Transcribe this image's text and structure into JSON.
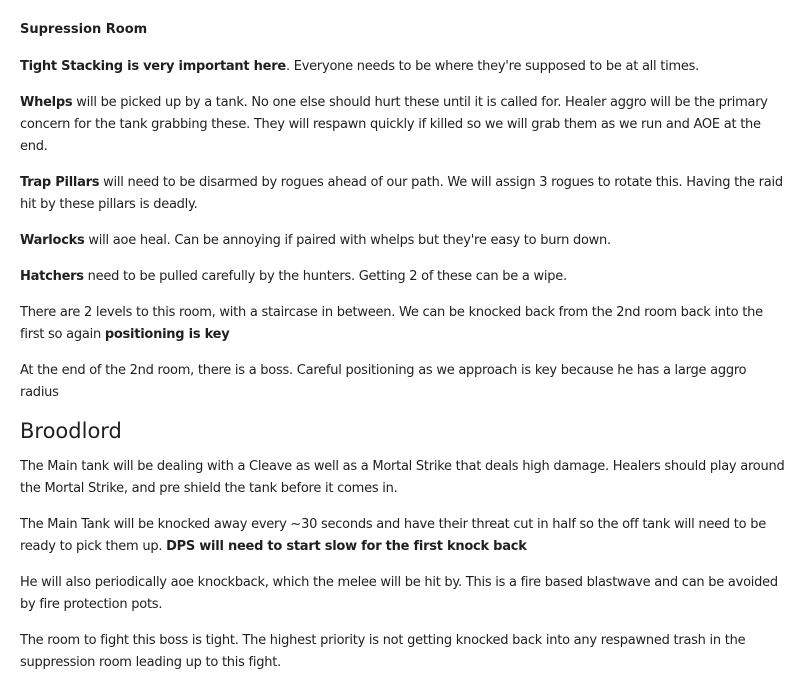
{
  "suppression": {
    "heading": "Supression Room",
    "p1": {
      "bold": "Tight Stacking is very important here",
      "rest": ". Everyone needs to be where they're supposed to be at all times."
    },
    "p2": {
      "bold": "Whelps",
      "rest": " will be picked up by a tank. No one else should hurt these until it is called for. Healer aggro will be the primary concern for the tank grabbing these. They will respawn quickly if killed so we will grab them as we run and AOE at the end."
    },
    "p3": {
      "bold": "Trap Pillars",
      "rest": " will need to be disarmed by rogues ahead of our path. We will assign 3 rogues to rotate this. Having the raid hit by these pillars is deadly."
    },
    "p4": {
      "bold": "Warlocks",
      "rest": " will aoe heal. Can be annoying if paired with whelps but they're easy to burn down."
    },
    "p5": {
      "bold": "Hatchers",
      "rest": " need to be pulled carefully by the hunters. Getting 2 of these can be a wipe."
    },
    "p6": {
      "text": "There are 2 levels to this room, with a staircase in between. We can be knocked back from the 2nd room back into the first so again ",
      "bold": "positioning is key"
    },
    "p7": {
      "text": "At the end of the 2nd room, there is a boss. Careful positioning as we approach is key because he has a large aggro radius"
    }
  },
  "broodlord": {
    "heading": "Broodlord",
    "p1": {
      "text": "The Main tank will be dealing with a Cleave as well as a Mortal Strike that deals high damage. Healers should play around the Mortal Strike, and pre shield the tank before it comes in."
    },
    "p2": {
      "text": "The Main Tank will be knocked away every ~30 seconds and have their threat cut in half so the off tank will need to be ready to pick them up. ",
      "bold": "DPS will need to start slow for the first knock back"
    },
    "p3": {
      "text": "He will also periodically aoe knockback, which the melee will be hit by. This is a fire based blastwave and can be avoided by fire protection pots."
    },
    "p4": {
      "text": "The room to fight this boss is tight. The highest priority is not getting knocked back into any respawned trash in the suppression room leading up to this fight."
    }
  }
}
